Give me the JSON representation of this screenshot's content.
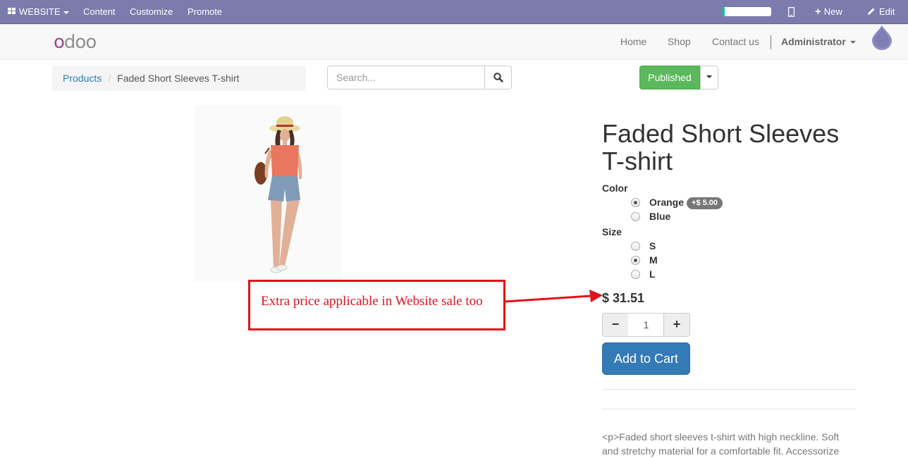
{
  "adminbar": {
    "website_label": "WEBSITE",
    "menus": [
      "Content",
      "Customize",
      "Promote"
    ],
    "progress_fraction": 0.06,
    "new_label": "New",
    "edit_label": "Edit"
  },
  "navbar": {
    "logo_text": "odoo",
    "links": [
      "Home",
      "Shop",
      "Contact us"
    ],
    "user": "Administrator"
  },
  "breadcrumb": {
    "parent": "Products",
    "current": "Faded Short Sleeves T-shirt"
  },
  "search": {
    "placeholder": "Search..."
  },
  "publish": {
    "label": "Published"
  },
  "annotation": {
    "text": "Extra price applicable in Website sale too"
  },
  "product": {
    "title": "Faded Short Sleeves T-shirt",
    "attributes": [
      {
        "name": "Color",
        "options": [
          {
            "label": "Orange",
            "checked": true,
            "extra": "+$ 5.00"
          },
          {
            "label": "Blue",
            "checked": false
          }
        ]
      },
      {
        "name": "Size",
        "options": [
          {
            "label": "S",
            "checked": false
          },
          {
            "label": "M",
            "checked": true
          },
          {
            "label": "L",
            "checked": false
          }
        ]
      }
    ],
    "price": "$ 31.51",
    "quantity": "1",
    "add_to_cart": "Add to Cart",
    "description": "<p>Faded short sleeves t-shirt with high neckline. Soft and stretchy material for a comfortable fit. Accessorize"
  },
  "colors": {
    "adminbar": "#7c7bad",
    "published": "#5cb85c",
    "primary": "#337ab7",
    "annotation": "#e2121b",
    "progress": "#21b799"
  }
}
